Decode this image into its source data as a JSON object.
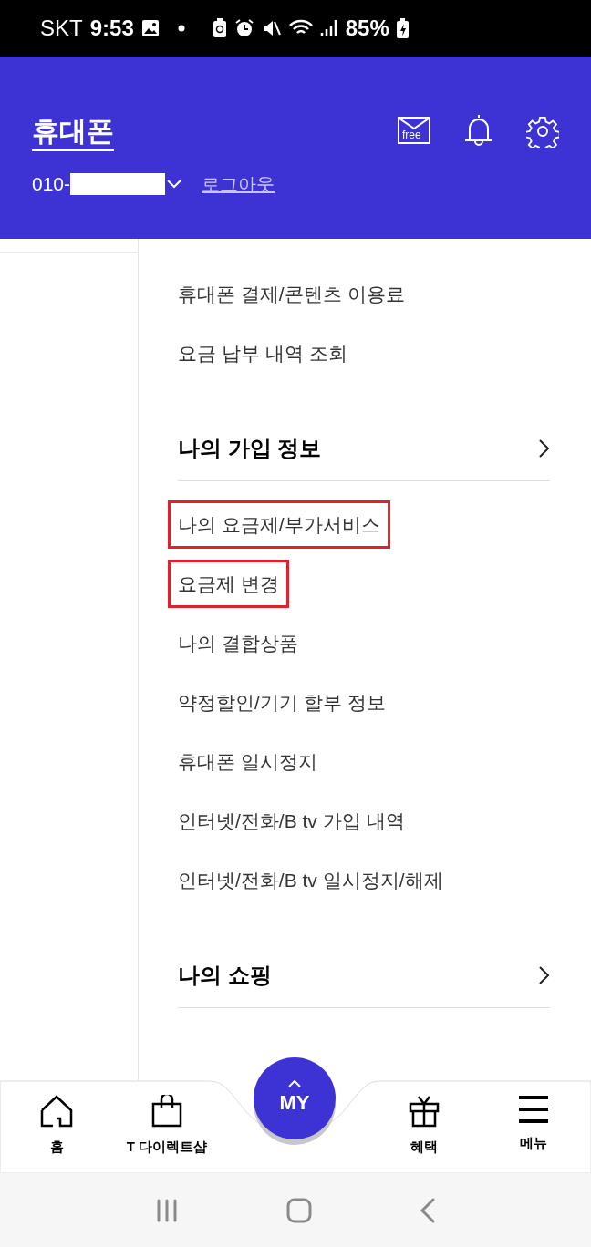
{
  "status_bar": {
    "carrier": "SKT",
    "time": "9:53",
    "battery": "85%"
  },
  "header": {
    "title": "휴대폰",
    "phone_prefix": "010-",
    "logout": "로그아웃",
    "mail_badge": "free"
  },
  "sections": [
    {
      "kind": "list",
      "items": [
        {
          "label": "휴대폰 결제/콘텐츠 이용료",
          "highlighted": false
        },
        {
          "label": "요금 납부 내역 조회",
          "highlighted": false
        }
      ]
    },
    {
      "kind": "section",
      "title": "나의 가입 정보",
      "items": [
        {
          "label": "나의 요금제/부가서비스",
          "highlighted": true
        },
        {
          "label": "요금제 변경",
          "highlighted": true
        },
        {
          "label": "나의 결합상품",
          "highlighted": false
        },
        {
          "label": "약정할인/기기 할부 정보",
          "highlighted": false
        },
        {
          "label": "휴대폰 일시정지",
          "highlighted": false
        },
        {
          "label": "인터넷/전화/B tv 가입 내역",
          "highlighted": false
        },
        {
          "label": "인터넷/전화/B tv 일시정지/해제",
          "highlighted": false
        }
      ]
    },
    {
      "kind": "section",
      "title": "나의 쇼핑"
    }
  ],
  "bottom_nav": [
    {
      "kind": "home",
      "label": "홈"
    },
    {
      "kind": "shop",
      "label": "T 다이렉트샵"
    },
    {
      "kind": "my",
      "label": "MY"
    },
    {
      "kind": "gift",
      "label": "혜택"
    },
    {
      "kind": "menu",
      "label": "메뉴"
    }
  ]
}
